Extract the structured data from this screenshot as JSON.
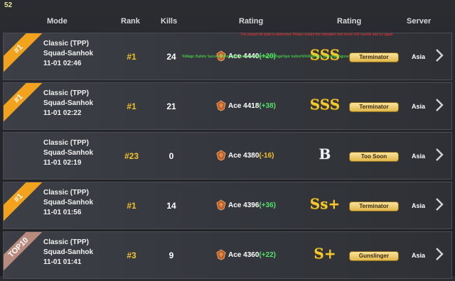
{
  "counter": "52",
  "header": {
    "mode": "Mode",
    "rank": "Rank",
    "kills": "Kills",
    "rating": "Rating",
    "grade": "Rating",
    "server": "Server"
  },
  "overlay": {
    "red": "The instant hit state is abnormal. Please restart the simulator and shoot 100 rounds and try again",
    "green": "%Magic Bullets Success%Restart%ZeroRecoil Success %Page%pic button%%Wallhack get range%gone"
  },
  "colors": {
    "gold": "#f3c22b",
    "positive": "#55e06a",
    "ribbon_first": "#f2a21d",
    "ribbon_top10": "#b98a7e"
  },
  "matches": [
    {
      "ribbon": "#1",
      "ribbon_type": "first",
      "mode": "Classic (TPP)",
      "map": "Squad-Sanhok",
      "time": "11-01 02:46",
      "rank": "#1",
      "kills": "24",
      "tier": "Ace",
      "rating": "4440",
      "delta": "(+20)",
      "delta_sign": "pos",
      "grade": "SSS",
      "grade_style": "gold",
      "title": "Terminator",
      "server": "Asia"
    },
    {
      "ribbon": "#1",
      "ribbon_type": "first",
      "mode": "Classic (TPP)",
      "map": "Squad-Sanhok",
      "time": "11-01 02:22",
      "rank": "#1",
      "kills": "21",
      "tier": "Ace",
      "rating": "4418",
      "delta": "(+38)",
      "delta_sign": "pos",
      "grade": "SSS",
      "grade_style": "gold",
      "title": "Terminator",
      "server": "Asia"
    },
    {
      "ribbon": "",
      "ribbon_type": "none",
      "mode": "Classic (TPP)",
      "map": "Squad-Sanhok",
      "time": "11-01 02:19",
      "rank": "#23",
      "kills": "0",
      "tier": "Ace",
      "rating": "4380",
      "delta": "(-16)",
      "delta_sign": "neg",
      "grade": "B",
      "grade_style": "white",
      "title": "Too Soon",
      "server": "Asia"
    },
    {
      "ribbon": "#1",
      "ribbon_type": "first",
      "mode": "Classic (TPP)",
      "map": "Squad-Sanhok",
      "time": "11-01 01:56",
      "rank": "#1",
      "kills": "14",
      "tier": "Ace",
      "rating": "4396",
      "delta": "(+36)",
      "delta_sign": "pos",
      "grade": "Ss+",
      "grade_style": "gold",
      "title": "Terminator",
      "server": "Asia"
    },
    {
      "ribbon": "TOP10",
      "ribbon_type": "top10",
      "mode": "Classic (TPP)",
      "map": "Squad-Sanhok",
      "time": "11-01 01:41",
      "rank": "#3",
      "kills": "9",
      "tier": "Ace",
      "rating": "4360",
      "delta": "(+22)",
      "delta_sign": "pos",
      "grade": "S+",
      "grade_style": "gold",
      "title": "Gunslinger",
      "server": "Asia"
    }
  ]
}
